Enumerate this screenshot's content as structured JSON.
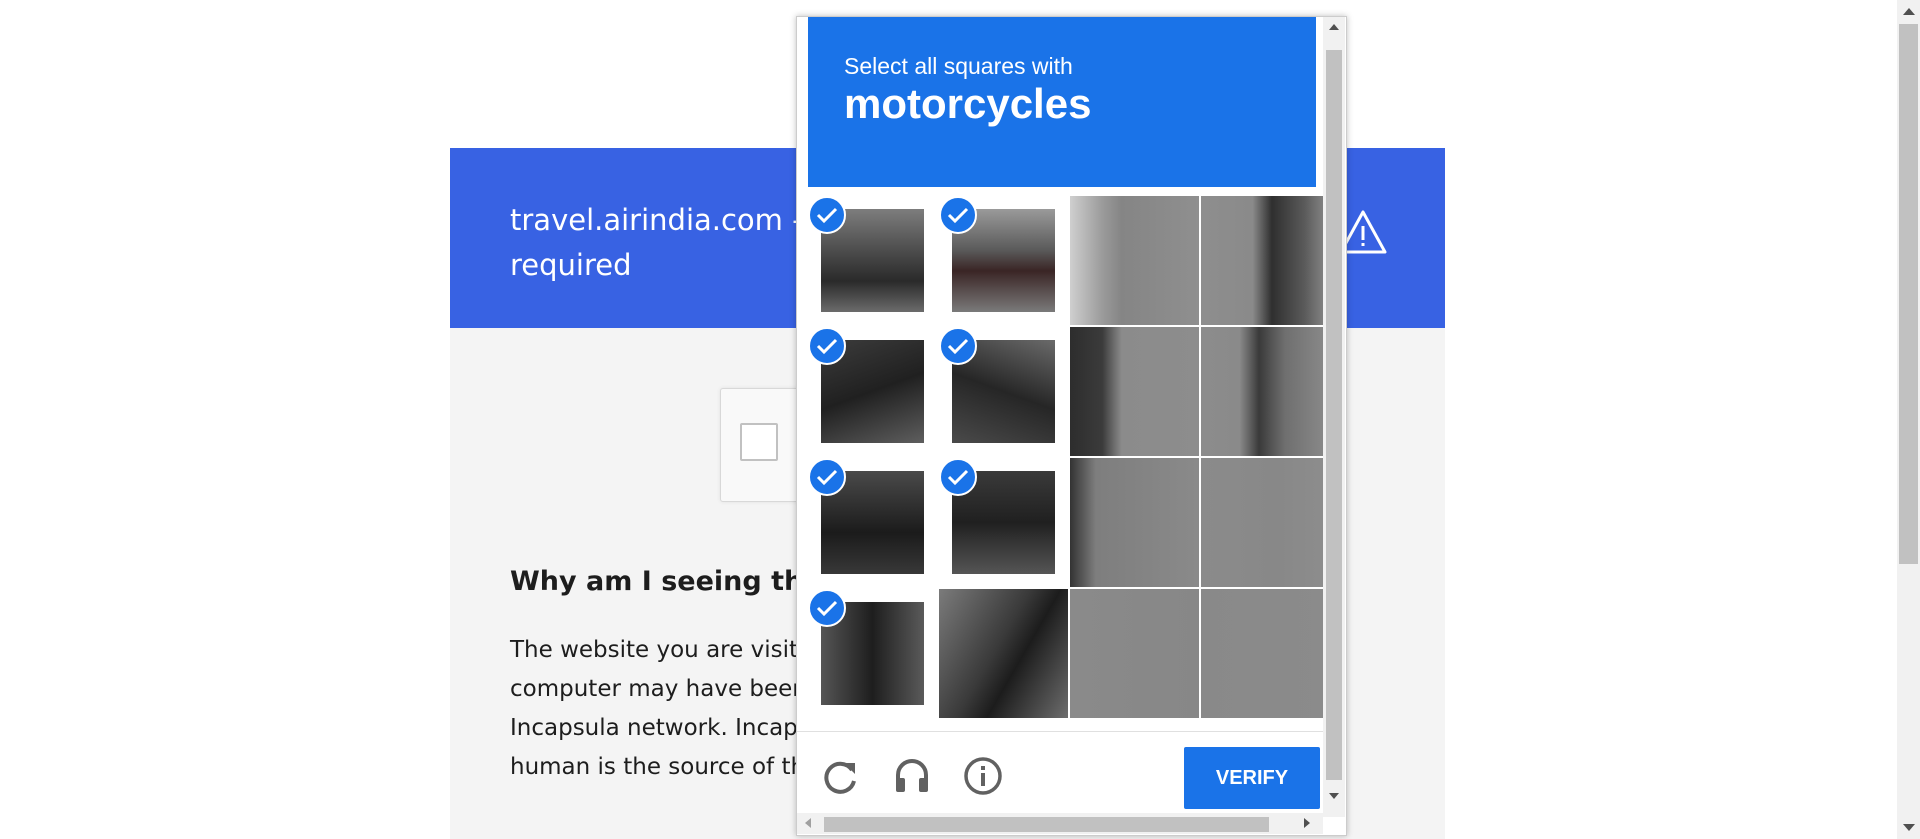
{
  "page": {
    "title": "travel.airindia.com - Additional security check is required",
    "title_line1": "travel.airindia.com -",
    "title_line2": "required",
    "heading": "Why am I seeing th",
    "paragraph_lines": [
      "The website you are visitin",
      "computer may have been in",
      "Incapsula network. Incapsu",
      "human is the source of the"
    ],
    "header_color": "#3862e3"
  },
  "captcha": {
    "instruction": "Select all squares with",
    "target": "motorcycles",
    "accent_color": "#1a73e8",
    "grid": {
      "rows": 4,
      "cols": 4,
      "selected": [
        [
          true,
          true,
          false,
          false
        ],
        [
          true,
          true,
          false,
          false
        ],
        [
          true,
          true,
          false,
          false
        ],
        [
          true,
          false,
          false,
          false
        ]
      ]
    },
    "footer": {
      "reload_icon": "reload-icon",
      "audio_icon": "headphones-icon",
      "info_icon": "info-icon",
      "verify_label": "VERIFY"
    }
  }
}
